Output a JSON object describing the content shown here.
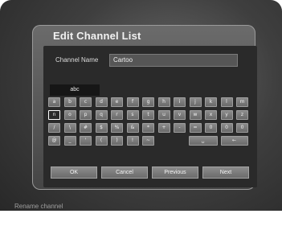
{
  "dialog": {
    "title": "Edit Channel List",
    "name_label": "Channel Name",
    "name_value": "Cartoo",
    "mode": "abc"
  },
  "keyboard": {
    "rows": [
      [
        "a",
        "b",
        "c",
        "d",
        "e",
        "f",
        "g",
        "h",
        "i",
        "j",
        "k",
        "l",
        "m"
      ],
      [
        "n",
        "o",
        "p",
        "q",
        "r",
        "s",
        "t",
        "u",
        "v",
        "w",
        "x",
        "y",
        "z"
      ],
      [
        "/",
        "\\",
        "#",
        "$",
        "%",
        "&",
        "*",
        "+",
        "-",
        "=",
        "0",
        "0",
        "0"
      ],
      [
        "@",
        "_",
        "'",
        "(",
        ")",
        "!",
        "~",
        "",
        "",
        "",
        "",
        "",
        ""
      ]
    ],
    "selected": "n",
    "special": {
      "space_label": "␣",
      "backspace_label": "←"
    }
  },
  "actions": {
    "ok": "OK",
    "cancel": "Cancel",
    "previous": "Previous",
    "next": "Next"
  },
  "hint": "Rename channel"
}
